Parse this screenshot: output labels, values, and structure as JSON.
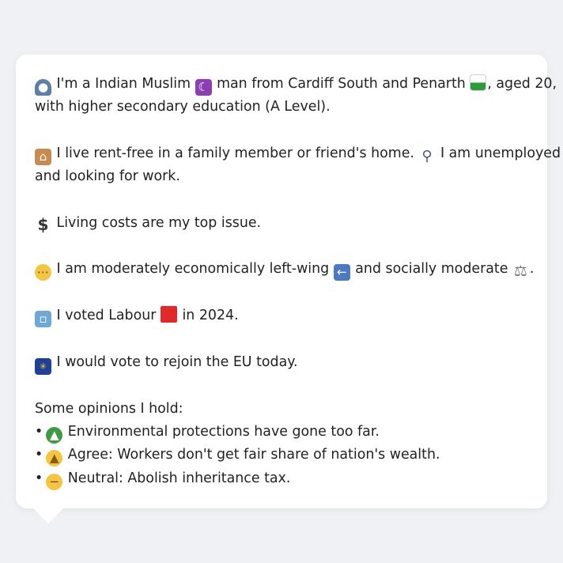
{
  "card": {
    "p1": {
      "l1_pre": "I'm a Indian Muslim",
      "l1_mid": "man from Cardiff South and Penarth",
      "l1_post": ", aged 20,",
      "l2": "with higher secondary education (A Level)."
    },
    "p2": {
      "l1_pre": "I live rent-free in a family member or friend's home.",
      "l1_post": "I am unemployed",
      "l2": "and looking for work."
    },
    "p3": {
      "text": "Living costs are my top issue."
    },
    "p4": {
      "pre": "I am moderately economically left-wing",
      "mid": "and socially moderate",
      "post": "."
    },
    "p5": {
      "pre": "I voted Labour",
      "post": "in 2024."
    },
    "p6": {
      "text": "I would vote to rejoin the EU today."
    },
    "opinions": {
      "heading": "Some opinions I hold:",
      "items": [
        {
          "text": "Environmental protections have gone too far."
        },
        {
          "text": "Agree: Workers don't get fair share of nation's wealth."
        },
        {
          "text": "Neutral: Abolish inheritance tax."
        }
      ]
    }
  },
  "icons": {
    "person": "person-icon",
    "crescent": "star-and-crescent-icon",
    "wales": "wales-flag-icon",
    "house": "house-icon",
    "search": "magnifying-glass-icon",
    "dollar": "dollar-sign-icon",
    "think": "thinking-face-icon",
    "left": "left-arrow-icon",
    "scale": "balance-scale-icon",
    "ballot": "ballot-box-icon",
    "red": "red-square-icon",
    "eu": "eu-flag-icon",
    "tree": "tree-icon",
    "thumb": "thumbs-up-icon",
    "neutral": "neutral-face-icon"
  },
  "colors": {
    "background": "#f0f1f4",
    "card": "#ffffff",
    "text": "#222226"
  }
}
